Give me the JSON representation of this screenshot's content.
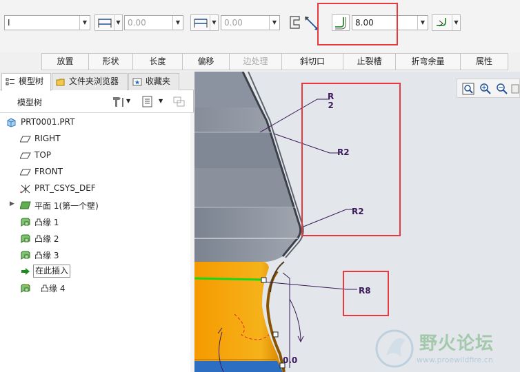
{
  "toolbar": {
    "type_select": "I",
    "thickness_value": "0.00",
    "offset_value": "0.00",
    "radius_value": "8.00"
  },
  "tabs": [
    {
      "label": "放置",
      "enabled": true
    },
    {
      "label": "形状",
      "enabled": true
    },
    {
      "label": "长度",
      "enabled": true
    },
    {
      "label": "偏移",
      "enabled": true
    },
    {
      "label": "边处理",
      "enabled": false
    },
    {
      "label": "斜切口",
      "enabled": true
    },
    {
      "label": "止裂槽",
      "enabled": true
    },
    {
      "label": "折弯余量",
      "enabled": true
    },
    {
      "label": "属性",
      "enabled": true
    }
  ],
  "panel": {
    "tabs": [
      "模型树",
      "文件夹浏览器",
      "收藏夹"
    ],
    "header": "模型树",
    "tree": [
      {
        "label": "PRT0001.PRT",
        "icon": "part-icon"
      },
      {
        "label": "RIGHT",
        "icon": "datum-plane-icon"
      },
      {
        "label": "TOP",
        "icon": "datum-plane-icon"
      },
      {
        "label": "FRONT",
        "icon": "datum-plane-icon"
      },
      {
        "label": "PRT_CSYS_DEF",
        "icon": "csys-icon"
      },
      {
        "label": "平面 1(第一个壁)",
        "icon": "flat-wall-icon"
      },
      {
        "label": "凸缘 1",
        "icon": "flange-icon"
      },
      {
        "label": "凸缘 2",
        "icon": "flange-icon"
      },
      {
        "label": "凸缘 3",
        "icon": "flange-icon"
      },
      {
        "label": "在此插入",
        "icon": "insert-here-icon"
      },
      {
        "label": "凸缘 4",
        "icon": "flange-new-icon"
      }
    ]
  },
  "graphics": {
    "labels": [
      "R\n2",
      "R2",
      "R2",
      "R8"
    ],
    "partial_dim": "0.0",
    "watermark": {
      "title": "野火论坛",
      "url": "www.proewildfire.cn"
    }
  },
  "colors": {
    "highlight": "#e8383d",
    "part_orange": "#f2a300",
    "sheet_gray": "#8f96a2",
    "dim_purple": "#3a1a5a"
  }
}
